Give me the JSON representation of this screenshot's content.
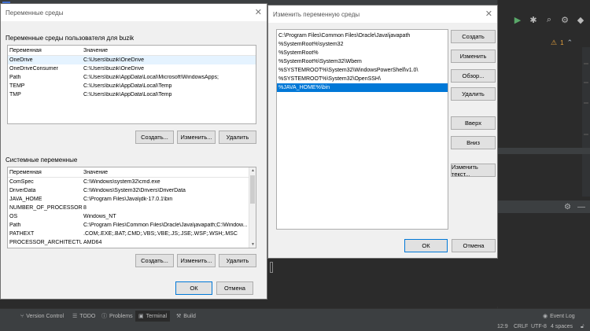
{
  "ide": {
    "toolbar_icons": [
      "run-icon",
      "debug-icon",
      "search-icon",
      "gear-icon",
      "ide-logo-icon"
    ],
    "warnings": {
      "count": "1",
      "icon": "warning-icon"
    },
    "status_tabs": [
      {
        "label": "Version Control",
        "icon": "branch-icon"
      },
      {
        "label": "TODO",
        "icon": "list-icon"
      },
      {
        "label": "Problems",
        "icon": "info-icon"
      },
      {
        "label": "Terminal",
        "icon": "terminal-icon"
      },
      {
        "label": "Build",
        "icon": "hammer-icon"
      }
    ],
    "event_log": "Event Log",
    "position": "12:9",
    "line_sep": "CRLF",
    "encoding": "UTF-8",
    "indent": "4 spaces",
    "colors": {
      "bg": "#2b2b2b",
      "panel": "#3c3f41",
      "accent": "#0078d7"
    }
  },
  "env_dialog": {
    "title": "Переменные среды",
    "user_group": "Переменные среды пользователя для buzik",
    "columns": [
      "Переменная",
      "Значение"
    ],
    "user_vars": [
      {
        "name": "OneDrive",
        "value": "C:\\Users\\buzik\\OneDrive"
      },
      {
        "name": "OneDriveConsumer",
        "value": "C:\\Users\\buzik\\OneDrive"
      },
      {
        "name": "Path",
        "value": "C:\\Users\\buzik\\AppData\\Local\\Microsoft\\WindowsApps;"
      },
      {
        "name": "TEMP",
        "value": "C:\\Users\\buzik\\AppData\\Local\\Temp"
      },
      {
        "name": "TMP",
        "value": "C:\\Users\\buzik\\AppData\\Local\\Temp"
      }
    ],
    "user_buttons": {
      "create": "Создать...",
      "edit": "Изменить...",
      "delete": "Удалить"
    },
    "system_group": "Системные переменные",
    "system_vars": [
      {
        "name": "ComSpec",
        "value": "C:\\Windows\\system32\\cmd.exe"
      },
      {
        "name": "DriverData",
        "value": "C:\\Windows\\System32\\Drivers\\DriverData"
      },
      {
        "name": "JAVA_HOME",
        "value": "C:\\Program Files\\Java\\jdk-17.0.1\\bin"
      },
      {
        "name": "NUMBER_OF_PROCESSORS",
        "value": "8"
      },
      {
        "name": "OS",
        "value": "Windows_NT"
      },
      {
        "name": "Path",
        "value": "C:\\Program Files\\Common Files\\Oracle\\Java\\javapath;C:\\Window..."
      },
      {
        "name": "PATHEXT",
        "value": ".COM;.EXE;.BAT;.CMD;.VBS;.VBE;.JS;.JSE;.WSF;.WSH;.MSC"
      },
      {
        "name": "PROCESSOR_ARCHITECTURE",
        "value": "AMD64"
      }
    ],
    "system_buttons": {
      "create": "Создать...",
      "edit": "Изменить...",
      "delete": "Удалить"
    },
    "ok": "ОК",
    "cancel": "Отмена"
  },
  "edit_dialog": {
    "title": "Изменить переменную среды",
    "paths": [
      "C:\\Program Files\\Common Files\\Oracle\\Java\\javapath",
      "%SystemRoot%\\system32",
      "%SystemRoot%",
      "%SystemRoot%\\System32\\Wbem",
      "%SYSTEMROOT%\\System32\\WindowsPowerShell\\v1.0\\",
      "%SYSTEMROOT%\\System32\\OpenSSH\\",
      "%JAVA_HOME%\\bin"
    ],
    "selected_index": 6,
    "buttons": {
      "create": "Создать",
      "edit": "Изменить",
      "browse": "Обзор...",
      "delete": "Удалить",
      "up": "Вверх",
      "down": "Вниз",
      "edit_text": "Изменить текст..."
    },
    "ok": "ОК",
    "cancel": "Отмена"
  }
}
